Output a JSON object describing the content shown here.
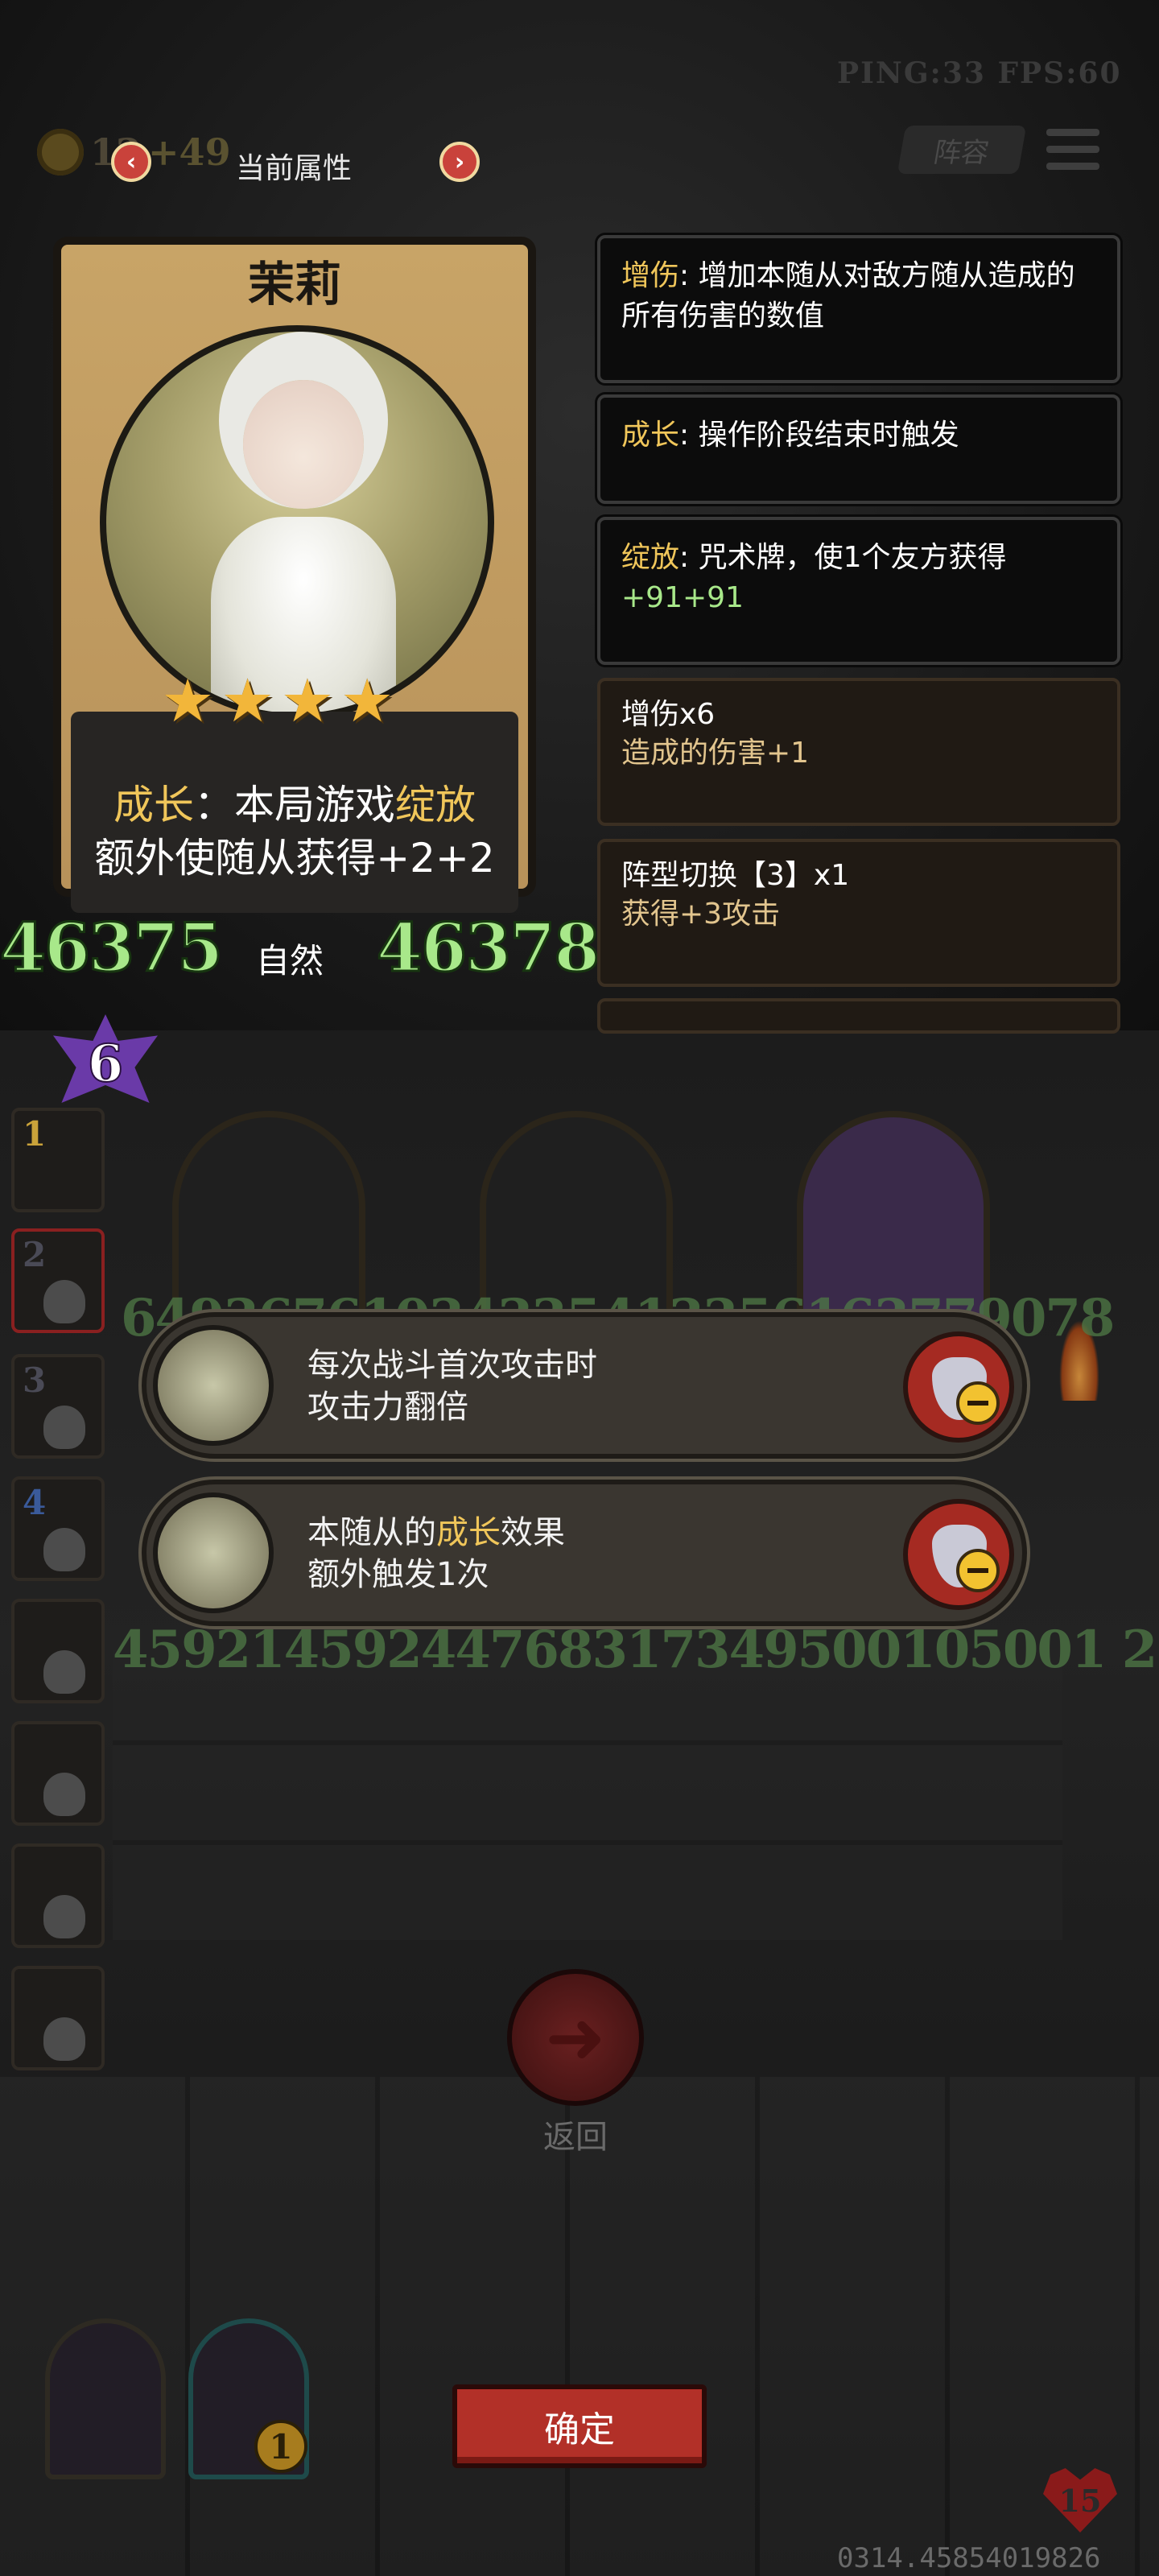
{
  "hud": {
    "ping_fps": "PING:33   FPS:60",
    "coins": "12",
    "coins_plus": "+49",
    "lineup": "阵容"
  },
  "panel": {
    "title": "当前属性",
    "prev": "‹",
    "next": "›"
  },
  "hero": {
    "name": "茉莉",
    "stars": 4,
    "desc_prefix": "成长",
    "desc_mid": "：本局游戏",
    "desc_keyword": "绽放",
    "desc_line2": "额外使随从获得+2+2",
    "attack": "46375",
    "element": "自然",
    "health": "46378",
    "level": "6"
  },
  "effects": [
    {
      "key": "增伤",
      "text": ": 增加本随从对敌方随从造成的所有伤害的数值"
    },
    {
      "key": "成长",
      "text": ": 操作阶段结束时触发"
    },
    {
      "key": "绽放",
      "text": ": 咒术牌，使1个友方获得",
      "extra": "+91+91"
    }
  ],
  "buffs": [
    {
      "title": "增伤x6",
      "sub": "造成的伤害+1"
    },
    {
      "title": "阵型切换【3】x1",
      "sub": "获得+3攻击"
    }
  ],
  "slots": [
    "1",
    "2",
    "3",
    "4",
    "",
    "",
    "",
    ""
  ],
  "abilities": [
    {
      "line1": "每次战斗首次攻击时",
      "line2": "攻击力翻倍"
    },
    {
      "line1_pre": "本随从的",
      "line1_key": "成长",
      "line1_post": "效果",
      "line2": "额外触发1次"
    }
  ],
  "bg_digits": {
    "row1": "64936761034335413356163779078",
    "row2": "45921459244768317349500105001 2"
  },
  "bottom": {
    "return_label": "返回",
    "return_icon": "arrow-left",
    "confirm": "确定",
    "door_count": "1",
    "hp": "15",
    "coord": "0314.45854019826"
  },
  "colors": {
    "gold": "#f0c65a",
    "green": "#a8e88a",
    "red_button": "#b23028"
  }
}
